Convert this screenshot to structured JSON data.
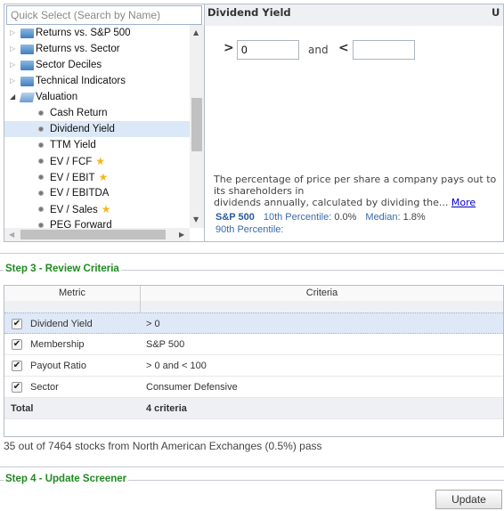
{
  "search": {
    "placeholder": "Quick Select (Search by Name)"
  },
  "tree": {
    "folders": [
      {
        "label": "Returns vs. S&P 500",
        "expanded": false
      },
      {
        "label": "Returns vs. Sector",
        "expanded": false
      },
      {
        "label": "Sector Deciles",
        "expanded": false
      },
      {
        "label": "Technical Indicators",
        "expanded": false
      },
      {
        "label": "Valuation",
        "expanded": true
      }
    ],
    "leaves": [
      {
        "label": "Cash Return",
        "star": false
      },
      {
        "label": "Dividend Yield",
        "star": false,
        "selected": true
      },
      {
        "label": "TTM Yield",
        "star": false
      },
      {
        "label": "EV / FCF",
        "star": true
      },
      {
        "label": "EV / EBIT",
        "star": true
      },
      {
        "label": "EV / EBITDA",
        "star": false
      },
      {
        "label": "EV / Sales",
        "star": true
      },
      {
        "label": "PEG Forward",
        "star": false
      }
    ]
  },
  "detail": {
    "title": "Dividend Yield",
    "right_label": "U",
    "gt_symbol": ">",
    "lt_symbol": "<",
    "gt_value": "0",
    "lt_value": "",
    "and_label": "and",
    "desc_line1": "The percentage of price per share a company pays out to its shareholders in",
    "desc_line2": "dividends annually, calculated by dividing the... ",
    "more_link": "More",
    "stats": {
      "index": "S&P 500",
      "p10_label": "10th Percentile:",
      "p10": "0.0%",
      "median_label": "Median:",
      "median": "1.8%",
      "p90_label": "90th Percentile:"
    }
  },
  "step3": {
    "title": "Step 3 - Review Criteria"
  },
  "table": {
    "headers": [
      "Metric",
      "Criteria"
    ],
    "rows": [
      {
        "metric": "Dividend Yield",
        "criteria": "> 0",
        "checked": true
      },
      {
        "metric": "Membership",
        "criteria": "S&P 500",
        "checked": true
      },
      {
        "metric": "Payout Ratio",
        "criteria": "> 0 and < 100",
        "checked": true
      },
      {
        "metric": "Sector",
        "criteria": "Consumer Defensive",
        "checked": true
      }
    ],
    "total": {
      "metric": "Total",
      "criteria": "4 criteria"
    }
  },
  "status": "35 out of 7464 stocks from North American Exchanges (0.5%) pass",
  "step4": {
    "title": "Step 4 - Update Screener",
    "button": "Update"
  },
  "colors": {
    "accent_green": "#1f8a1f",
    "link_blue": "#3a6aa8",
    "selected_row": "#dbe8f8"
  }
}
